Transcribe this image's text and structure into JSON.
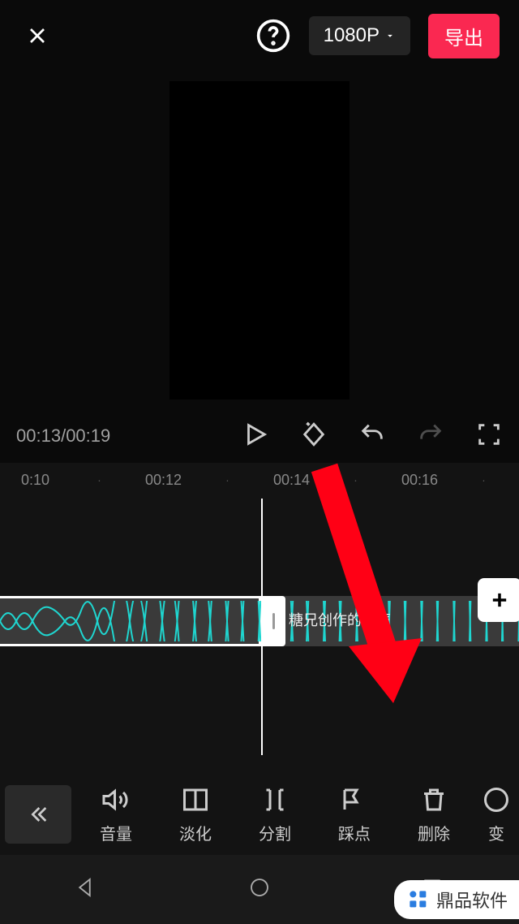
{
  "header": {
    "resolution": "1080P",
    "export": "导出"
  },
  "player": {
    "current_time": "00:13",
    "total_time": "00:19"
  },
  "timeline": {
    "marks": [
      "0:10",
      "·",
      "00:12",
      "·",
      "00:14",
      "·",
      "00:16",
      "·"
    ],
    "audio_label": "糖兄创作的原声"
  },
  "tools": {
    "volume": "音量",
    "fade": "淡化",
    "split": "分割",
    "beat": "踩点",
    "delete": "删除",
    "transform": "变"
  },
  "watermark": {
    "brand": "鼎品软件"
  }
}
